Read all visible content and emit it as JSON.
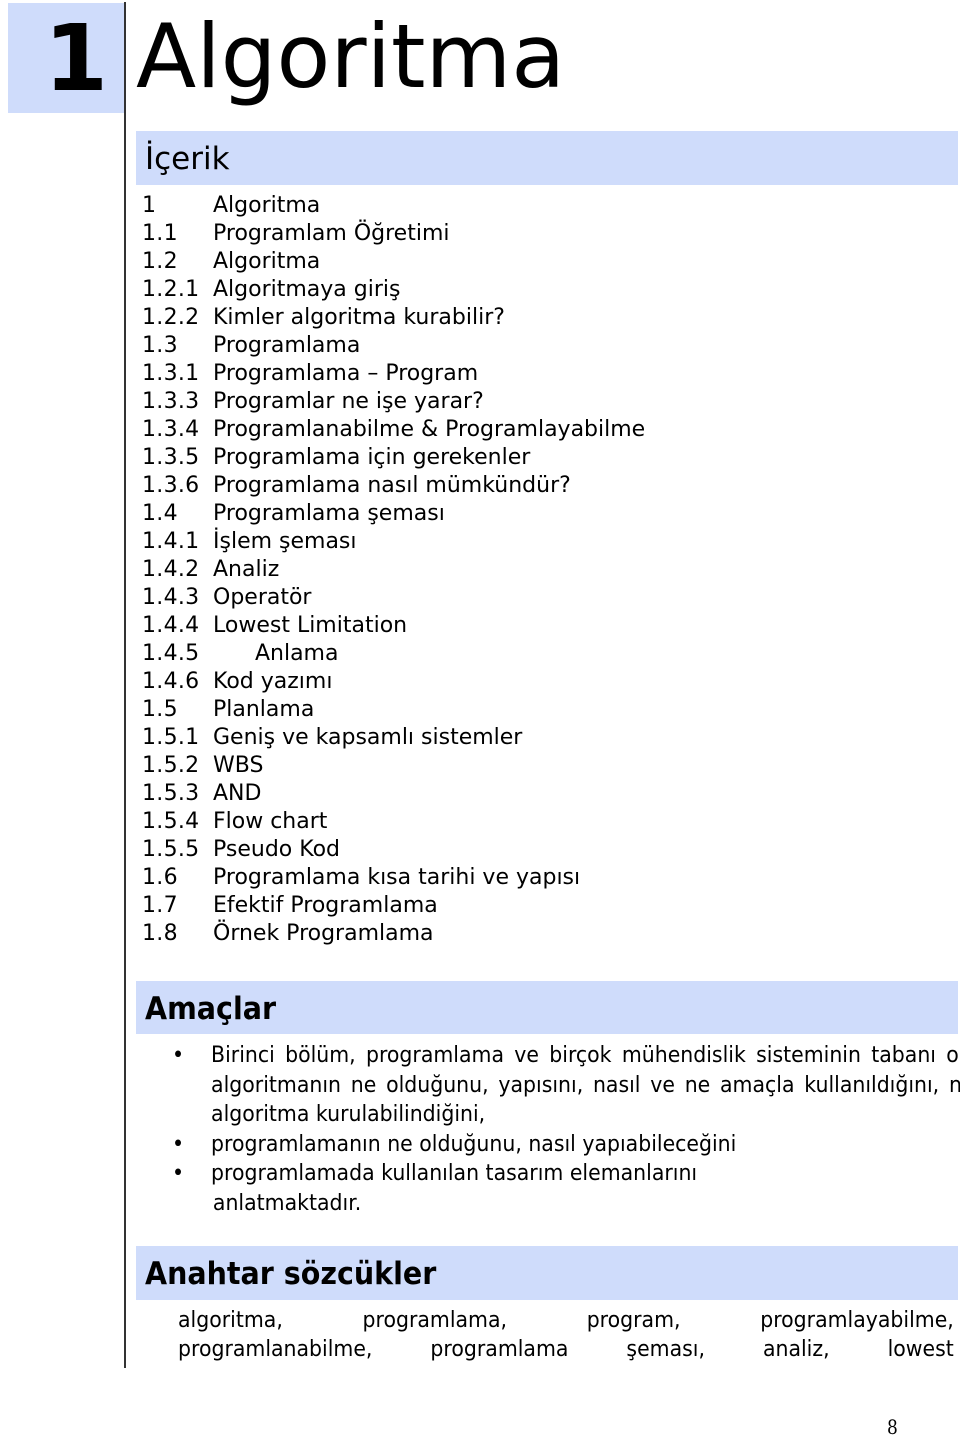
{
  "chapter": {
    "number": "1",
    "title": "Algoritma"
  },
  "toc": {
    "heading": "İçerik",
    "items": [
      {
        "num": "1",
        "label": "Algoritma"
      },
      {
        "num": "1.1",
        "label": "Programlam Öğretimi"
      },
      {
        "num": "1.2",
        "label": "Algoritma"
      },
      {
        "num": "1.2.1",
        "label": "Algoritmaya giriş"
      },
      {
        "num": "1.2.2",
        "label": "Kimler algoritma kurabilir?"
      },
      {
        "num": "1.3",
        "label": "Programlama"
      },
      {
        "num": "1.3.1",
        "label": "Programlama – Program"
      },
      {
        "num": "1.3.3",
        "label": "Programlar ne işe yarar?"
      },
      {
        "num": "1.3.4",
        "label": "Programlanabilme & Programlayabilme"
      },
      {
        "num": "1.3.5",
        "label": "Programlama için gerekenler"
      },
      {
        "num": "1.3.6",
        "label": "Programlama nasıl mümkündür?"
      },
      {
        "num": "1.4",
        "label": "Programlama şeması"
      },
      {
        "num": "1.4.1",
        "label": "İşlem şeması"
      },
      {
        "num": "1.4.2",
        "label": "Analiz"
      },
      {
        "num": "1.4.3",
        "label": "Operatör"
      },
      {
        "num": "1.4.4",
        "label": "Lowest Limitation"
      },
      {
        "num": "1.4.5",
        "label": "      Anlama"
      },
      {
        "num": "1.4.6",
        "label": "Kod yazımı"
      },
      {
        "num": "1.5",
        "label": "Planlama"
      },
      {
        "num": "1.5.1",
        "label": "Geniş ve kapsamlı sistemler"
      },
      {
        "num": "1.5.2",
        "label": "WBS"
      },
      {
        "num": "1.5.3",
        "label": "AND"
      },
      {
        "num": "1.5.4",
        "label": "Flow chart"
      },
      {
        "num": "1.5.5",
        "label": "Pseudo Kod"
      },
      {
        "num": "1.6",
        "label": "Programlama kısa tarihi ve yapısı"
      },
      {
        "num": "1.7",
        "label": "Efektif Programlama"
      },
      {
        "num": "1.8",
        "label": "Örnek Programlama"
      }
    ]
  },
  "goals": {
    "heading": "Amaçlar",
    "bullet_icon": "•",
    "items": [
      "Birinci bölüm, programlama ve birçok mühendislik sisteminin tabanı olan, algoritmanın ne olduğunu, yapısını, nasıl ve ne amaçla kullanıldığını, nasıl algoritma kurulabilindiğini,",
      "programlamanın ne olduğunu, nasıl yapıabileceğini",
      "programlamada kullanılan tasarım elemanlarını"
    ],
    "continuation": "anlatmaktadır."
  },
  "keywords": {
    "heading": "Anahtar sözcükler",
    "lines": [
      "algoritma, programlama, program, programlayabilme,",
      "programlanabilme, programlama şeması, analiz, lowest"
    ]
  },
  "page_number": "8"
}
